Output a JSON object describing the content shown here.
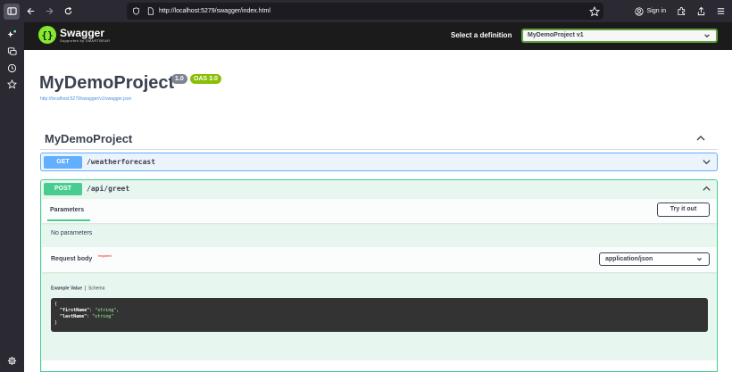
{
  "browser": {
    "url": "http://localhost:5279/swagger/index.html",
    "sign_in": "Sign in"
  },
  "header": {
    "logo_name": "Swagger",
    "logo_sub": "Supported by SMARTBEAR",
    "definition_label": "Select a definition",
    "definition_value": "MyDemoProject v1"
  },
  "info": {
    "title": "MyDemoProject",
    "version_badge": "1.0",
    "oas_badge": "OAS 3.0",
    "spec_link": "http://localhost:5279/swagger/v1/swagger.json"
  },
  "tag": {
    "name": "MyDemoProject"
  },
  "operations": [
    {
      "method": "GET",
      "path": "/weatherforecast"
    },
    {
      "method": "POST",
      "path": "/api/greet"
    }
  ],
  "post_details": {
    "parameters_tab": "Parameters",
    "try_button": "Try it out",
    "no_parameters": "No parameters",
    "request_body_label": "Request body",
    "required_label": "required",
    "content_type": "application/json",
    "example_value_tab": "Example Value",
    "schema_tab": "Schema",
    "code_open": "{",
    "code_line1_key": "\"firstName\"",
    "code_line1_val": "\"string\"",
    "code_line2_key": "\"lastName\"",
    "code_line2_val": "\"string\"",
    "code_close": "}"
  },
  "colors": {
    "swagger_green": "#85ea2d",
    "get_blue": "#61affe",
    "post_green": "#49cc90",
    "badge_gray": "#7d8492",
    "oas_green": "#89bf04"
  }
}
